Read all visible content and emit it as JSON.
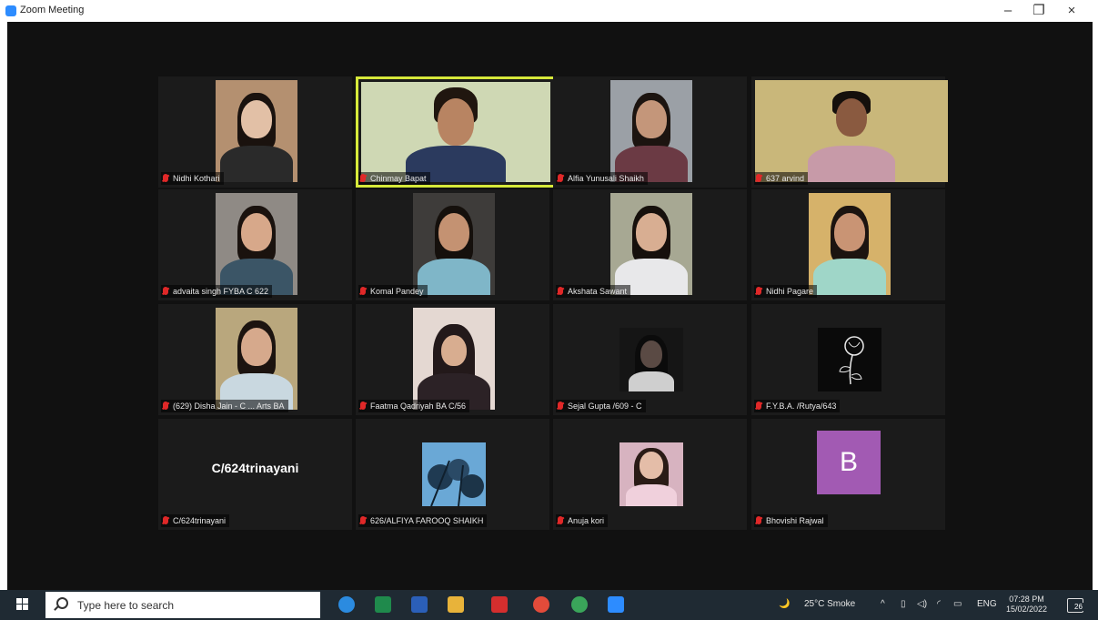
{
  "window": {
    "title": "Zoom Meeting",
    "minimize": "–",
    "restore": "❐",
    "close": "×"
  },
  "participants": [
    {
      "name": "Nidhi Kothari",
      "kind": "video"
    },
    {
      "name": "Chinmay Bapat",
      "kind": "video",
      "active_speaker": true
    },
    {
      "name": "Alfia Yunusali Shaikh",
      "kind": "video"
    },
    {
      "name": "637 arvind",
      "kind": "video"
    },
    {
      "name": "advaita singh FYBA C 622",
      "kind": "video"
    },
    {
      "name": "Komal Pandey",
      "kind": "video"
    },
    {
      "name": "Akshata Sawant",
      "kind": "video"
    },
    {
      "name": "Nidhi Pagare",
      "kind": "video"
    },
    {
      "name": "(629) Disha Jain - C ... Arts BA",
      "kind": "video"
    },
    {
      "name": "Faatma Qadriyah BA C/56",
      "kind": "video"
    },
    {
      "name": "Sejal Gupta /609 - C",
      "kind": "video"
    },
    {
      "name": "F.Y.B.A. /Rutya/643",
      "kind": "photo"
    },
    {
      "name": "C/624trinayani",
      "kind": "name-only",
      "display_name": "C/624trinayani"
    },
    {
      "name": "626/ALFIYA FAROOQ SHAIKH",
      "kind": "photo"
    },
    {
      "name": "Anuja kori",
      "kind": "photo"
    },
    {
      "name": "Bhovishi Rajwal",
      "kind": "avatar",
      "avatar_letter": "B",
      "avatar_color": "#a25ab3"
    }
  ],
  "taskbar": {
    "search_placeholder": "Type here to search",
    "weather": "25°C  Smoke",
    "language": "ENG",
    "time": "07:28 PM",
    "date": "15/02/2022",
    "notification_count": "26",
    "pinned_apps": [
      "edge-icon",
      "excel-icon",
      "word-icon",
      "file-explorer-icon",
      "acrobat-icon",
      "chrome-icon",
      "chrome-icon",
      "zoom-icon"
    ]
  },
  "colors": {
    "active_speaker_border": "#d6e93a",
    "meeting_background": "#111111",
    "zoom_blue": "#2d8cff",
    "taskbar": "#1f2a33"
  }
}
